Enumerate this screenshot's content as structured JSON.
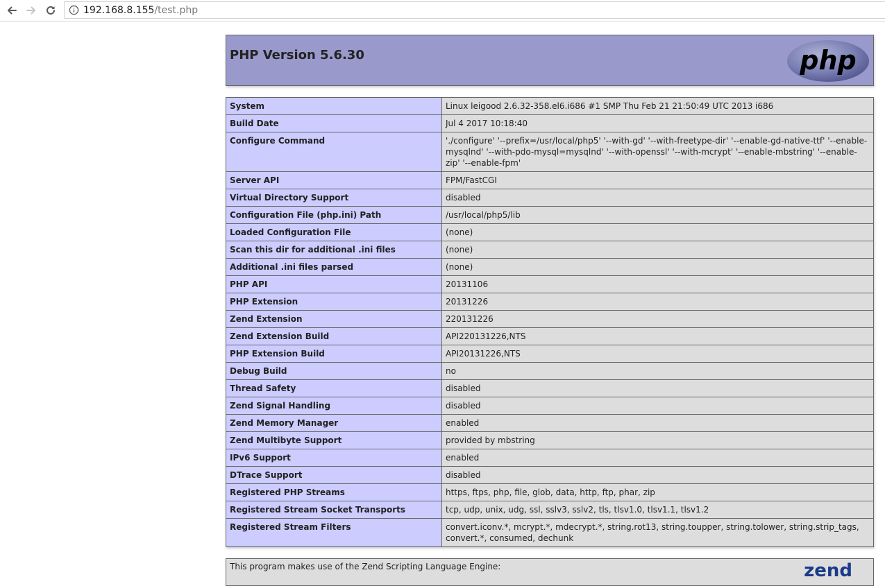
{
  "browser": {
    "url_host": "192.168.8.155",
    "url_path": "/test.php",
    "icons": {
      "back": "back-arrow-icon",
      "forward": "forward-arrow-icon",
      "reload": "reload-icon",
      "info": "info-icon"
    }
  },
  "header": {
    "title": "PHP Version 5.6.30",
    "logo_text": "php",
    "colors": {
      "header_bg": "#9999cc",
      "key_bg": "#ccccff",
      "value_bg": "#dddddd"
    }
  },
  "rows": [
    {
      "key": "System",
      "value": "Linux leigood 2.6.32-358.el6.i686 #1 SMP Thu Feb 21 21:50:49 UTC 2013 i686"
    },
    {
      "key": "Build Date",
      "value": "Jul 4 2017 10:18:40"
    },
    {
      "key": "Configure Command",
      "value": "'./configure' '--prefix=/usr/local/php5' '--with-gd' '--with-freetype-dir' '--enable-gd-native-ttf' '--enable-mysqlnd' '--with-pdo-mysql=mysqlnd' '--with-openssl' '--with-mcrypt' '--enable-mbstring' '--enable-zip' '--enable-fpm'"
    },
    {
      "key": "Server API",
      "value": "FPM/FastCGI"
    },
    {
      "key": "Virtual Directory Support",
      "value": "disabled"
    },
    {
      "key": "Configuration File (php.ini) Path",
      "value": "/usr/local/php5/lib"
    },
    {
      "key": "Loaded Configuration File",
      "value": "(none)"
    },
    {
      "key": "Scan this dir for additional .ini files",
      "value": "(none)"
    },
    {
      "key": "Additional .ini files parsed",
      "value": "(none)"
    },
    {
      "key": "PHP API",
      "value": "20131106"
    },
    {
      "key": "PHP Extension",
      "value": "20131226"
    },
    {
      "key": "Zend Extension",
      "value": "220131226"
    },
    {
      "key": "Zend Extension Build",
      "value": "API220131226,NTS"
    },
    {
      "key": "PHP Extension Build",
      "value": "API20131226,NTS"
    },
    {
      "key": "Debug Build",
      "value": "no"
    },
    {
      "key": "Thread Safety",
      "value": "disabled"
    },
    {
      "key": "Zend Signal Handling",
      "value": "disabled"
    },
    {
      "key": "Zend Memory Manager",
      "value": "enabled"
    },
    {
      "key": "Zend Multibyte Support",
      "value": "provided by mbstring"
    },
    {
      "key": "IPv6 Support",
      "value": "enabled"
    },
    {
      "key": "DTrace Support",
      "value": "disabled"
    },
    {
      "key": "Registered PHP Streams",
      "value": "https, ftps, php, file, glob, data, http, ftp, phar, zip"
    },
    {
      "key": "Registered Stream Socket Transports",
      "value": "tcp, udp, unix, udg, ssl, sslv3, sslv2, tls, tlsv1.0, tlsv1.1, tlsv1.2"
    },
    {
      "key": "Registered Stream Filters",
      "value": "convert.iconv.*, mcrypt.*, mdecrypt.*, string.rot13, string.toupper, string.tolower, string.strip_tags, convert.*, consumed, dechunk"
    }
  ],
  "footer": {
    "text": "This program makes use of the Zend Scripting Language Engine:",
    "logo_text": "zend"
  }
}
